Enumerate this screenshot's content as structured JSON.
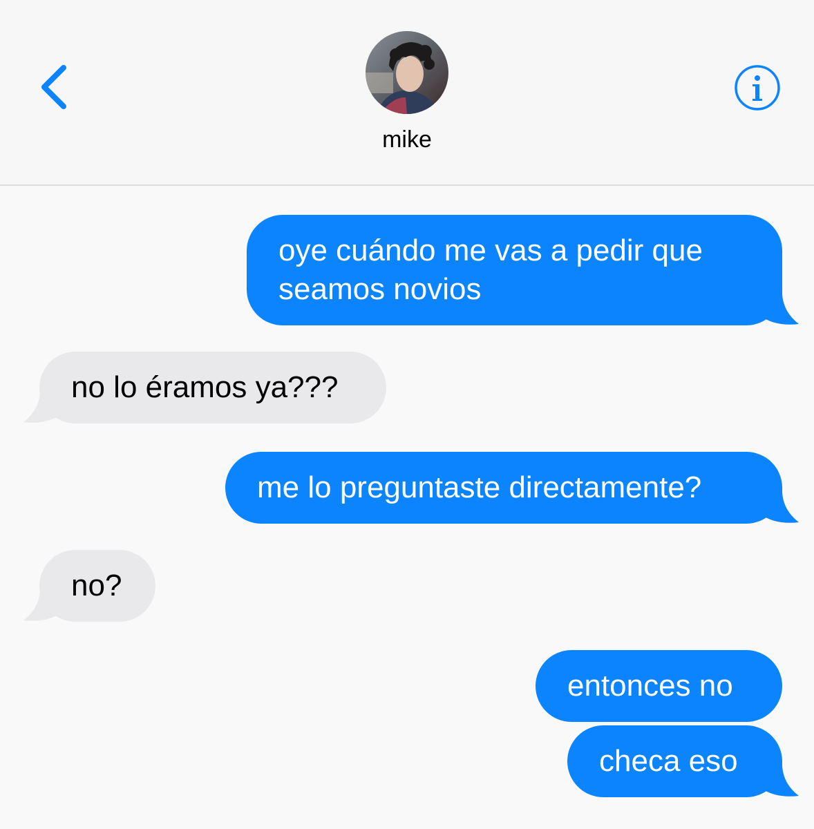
{
  "header": {
    "contact_name": "mike"
  },
  "messages": [
    {
      "direction": "sent",
      "lines": [
        "oye cuándo me vas a pedir que",
        "seamos novios"
      ]
    },
    {
      "direction": "received",
      "text": "no lo éramos ya???"
    },
    {
      "direction": "sent",
      "text": "me lo preguntaste directamente?"
    },
    {
      "direction": "received",
      "text": "no?"
    },
    {
      "direction": "sent",
      "text": "entonces no"
    },
    {
      "direction": "sent",
      "text": "checa eso"
    }
  ],
  "icons": {
    "back": "chevron-left-icon",
    "info": "info-icon"
  },
  "colors": {
    "sent_bubble": "#0b84fe",
    "received_bubble": "#e9e9eb",
    "accent": "#0b84fe",
    "background": "#f9f9f9"
  }
}
